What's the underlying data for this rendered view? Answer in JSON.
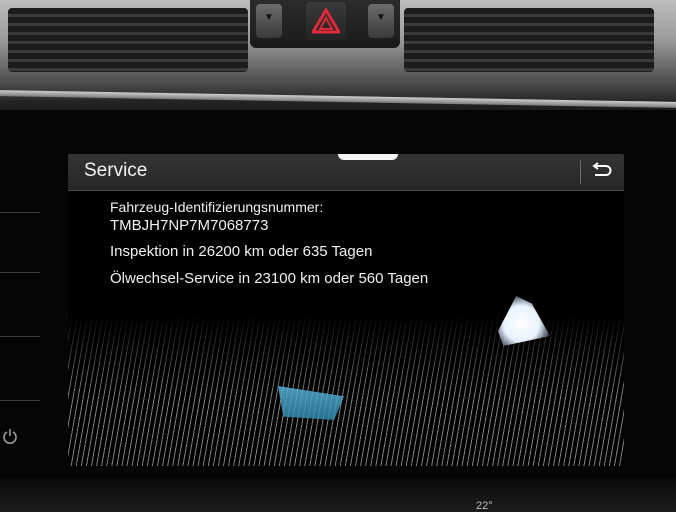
{
  "header": {
    "title": "Service"
  },
  "service": {
    "vin_label": "Fahrzeug-Identifizierungsnummer:",
    "vin_value": "TMBJH7NP7M7068773",
    "inspection": "Inspektion in 26200 km oder 635 Tagen",
    "oil_change": "Ölwechsel-Service in 23100 km oder 560 Tagen"
  },
  "icons": {
    "back": "back-arrow-icon",
    "hazard": "hazard-warning-icon",
    "power": "power-icon"
  },
  "colors": {
    "title_bar": "#2c2c2c",
    "text": "#f0f0f0",
    "hazard": "#e0283a"
  },
  "bottom_readout": "22°"
}
